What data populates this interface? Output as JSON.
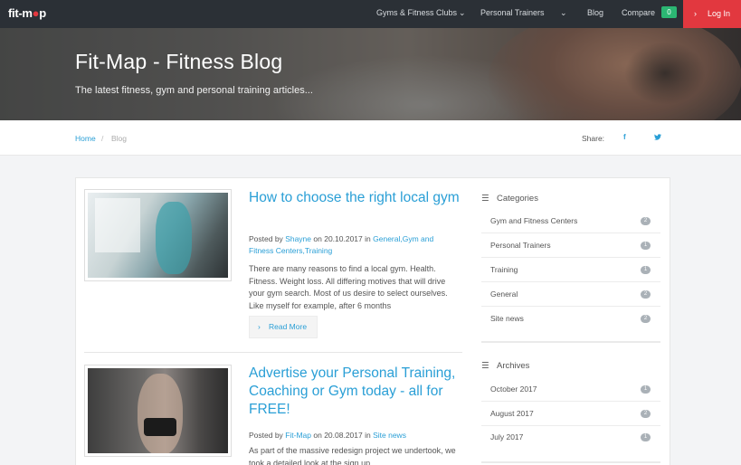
{
  "nav": {
    "logo_text": "fit-m",
    "logo_pin": "●",
    "logo_tail": "p",
    "items": [
      {
        "label": "Gyms & Fitness Clubs",
        "chev": "⌄"
      },
      {
        "label": "Personal Trainers",
        "chev": "⌄"
      },
      {
        "label": "Blog"
      },
      {
        "label": "Compare"
      }
    ],
    "compare_count": "0",
    "login_icon": "›",
    "login_label": "Log In"
  },
  "hero": {
    "title": "Fit-Map - Fitness Blog",
    "subtitle": "The latest fitness, gym and personal training articles..."
  },
  "breadcrumb": {
    "home": "Home",
    "separator": "/",
    "current": "Blog"
  },
  "share": {
    "label": "Share:",
    "facebook_icon": "f",
    "twitter_icon": "🐦"
  },
  "posts": [
    {
      "title": "How to choose the right local gym",
      "meta_prefix": "Posted by",
      "author": "Shayne",
      "date_text": "on 20.10.2017 in",
      "categories": "General,Gym and Fitness Centers,Training",
      "excerpt": "There are many reasons to find a local gym. Health. Fitness. Weight loss. All differing motives that will drive your gym search. Most of us desire to select ourselves. Like myself for example, after 6 months",
      "read_more_icon": "›",
      "read_more": "Read More"
    },
    {
      "title": "Advertise your Personal Training, Coaching or Gym today - all for FREE!",
      "meta_prefix": "Posted by",
      "author": "Fit-Map",
      "date_text": "on 20.08.2017 in",
      "categories": "Site news",
      "excerpt": "As part of the massive redesign project we undertook, we took a detailed look at the sign up"
    }
  ],
  "sidebar": {
    "categories_icon": "☰",
    "categories_title": "Categories",
    "categories": [
      {
        "label": "Gym and Fitness Centers",
        "count": "2"
      },
      {
        "label": "Personal Trainers",
        "count": "1"
      },
      {
        "label": "Training",
        "count": "1"
      },
      {
        "label": "General",
        "count": "2"
      },
      {
        "label": "Site news",
        "count": "2"
      }
    ],
    "archives_icon": "☰",
    "archives_title": "Archives",
    "archives": [
      {
        "label": "October 2017",
        "count": "1"
      },
      {
        "label": "August 2017",
        "count": "2"
      },
      {
        "label": "July 2017",
        "count": "1"
      }
    ]
  }
}
